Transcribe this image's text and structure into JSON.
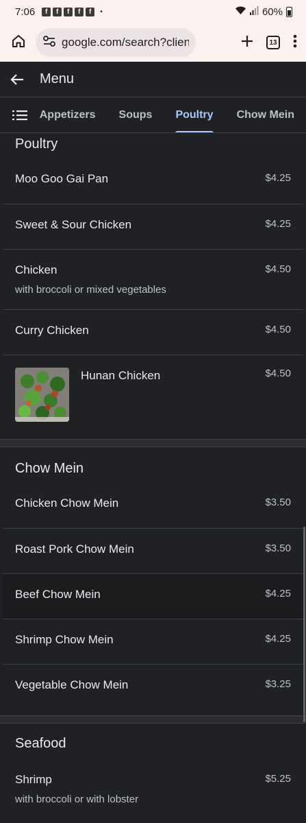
{
  "status": {
    "time": "7:06",
    "notification_icons": [
      "f",
      "f",
      "f",
      "f",
      "f"
    ],
    "dot": "•",
    "battery": "60%"
  },
  "browser": {
    "url": "google.com/search?client",
    "tab_count": "13"
  },
  "header": {
    "title": "Menu"
  },
  "tabs": [
    {
      "label": "Appetizers"
    },
    {
      "label": "Soups"
    },
    {
      "label": "Poultry"
    },
    {
      "label": "Chow Mein"
    }
  ],
  "sections": {
    "poultry": {
      "title": "Poultry",
      "items": [
        {
          "name": "Moo Goo Gai Pan",
          "price": "$4.25"
        },
        {
          "name": "Sweet & Sour Chicken",
          "price": "$4.25"
        },
        {
          "name": "Chicken",
          "desc": "with broccoli or mixed vegetables",
          "price": "$4.50"
        },
        {
          "name": "Curry Chicken",
          "price": "$4.50"
        },
        {
          "name": "Hunan Chicken",
          "price": "$4.50"
        }
      ]
    },
    "chow_mein": {
      "title": "Chow Mein",
      "items": [
        {
          "name": "Chicken Chow Mein",
          "price": "$3.50"
        },
        {
          "name": "Roast Pork Chow Mein",
          "price": "$3.50"
        },
        {
          "name": "Beef Chow Mein",
          "price": "$4.25"
        },
        {
          "name": "Shrimp Chow Mein",
          "price": "$4.25"
        },
        {
          "name": "Vegetable Chow Mein",
          "price": "$3.25"
        }
      ]
    },
    "seafood": {
      "title": "Seafood",
      "items": [
        {
          "name": "Shrimp",
          "desc": "with broccoli or with lobster",
          "price": "$5.25"
        }
      ]
    }
  },
  "colors": {
    "background": "#202124",
    "accent": "#a8c7fa",
    "browser_chrome": "#fbf1ee"
  },
  "icons": {
    "back": "arrow-left-icon",
    "tab_list": "list-icon",
    "home": "home-icon",
    "site_settings": "tune-icon",
    "new_tab": "plus-icon",
    "more": "more-vert-icon"
  }
}
